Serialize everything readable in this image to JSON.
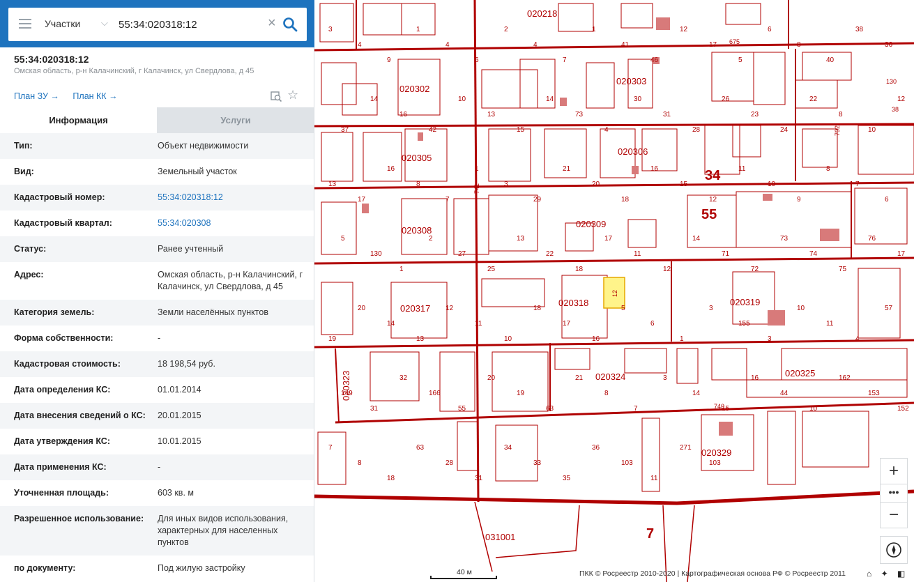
{
  "search": {
    "layer": "Участки",
    "value": "55:34:020318:12"
  },
  "object": {
    "title": "55:34:020318:12",
    "address": "Омская область, р-н Калачинский, г Калачинск, ул Свердлова, д 45",
    "plan_zu": "План ЗУ →",
    "plan_kk": "План КК →"
  },
  "tabs": {
    "info": "Информация",
    "services": "Услуги"
  },
  "properties": [
    {
      "k": "Тип:",
      "v": "Объект недвижимости"
    },
    {
      "k": "Вид:",
      "v": "Земельный участок"
    },
    {
      "k": "Кадастровый номер:",
      "v": "55:34:020318:12"
    },
    {
      "k": "Кадастровый квартал:",
      "v": "55:34:020308"
    },
    {
      "k": "Статус:",
      "v": "Ранее учтенный"
    },
    {
      "k": "Адрес:",
      "v": "Омская область, р-н Калачинский, г Калачинск, ул Свердлова, д 45"
    },
    {
      "k": "Категория земель:",
      "v": "Земли населённых пунктов"
    },
    {
      "k": "Форма собственности:",
      "v": "-"
    },
    {
      "k": "Кадастровая стоимость:",
      "v": "18 198,54 руб."
    },
    {
      "k": "Дата определения КС:",
      "v": "01.01.2014"
    },
    {
      "k": "Дата внесения сведений о КС:",
      "v": "20.01.2015"
    },
    {
      "k": "Дата утверждения КС:",
      "v": "10.01.2015"
    },
    {
      "k": "Дата применения КС:",
      "v": "-"
    },
    {
      "k": "Уточненная площадь:",
      "v": "603 кв. м"
    },
    {
      "k": "Разрешенное использование:",
      "v": "Для иных видов использования, характерных для населенных пунктов"
    },
    {
      "k": "по документу:",
      "v": "Под жилую застройку"
    }
  ],
  "map": {
    "quarters": [
      "020218",
      "020303",
      "020302",
      "020305",
      "020306",
      "020308",
      "020309",
      "020317",
      "020318",
      "020319",
      "020323",
      "020324",
      "020325",
      "020329",
      "031001"
    ],
    "district_labels": [
      "34",
      "55",
      "7"
    ],
    "street_labels": [
      "675",
      "740",
      "741",
      "792"
    ],
    "parcels": [
      "3",
      "4",
      "9",
      "1",
      "4",
      "6",
      "2",
      "4",
      "7",
      "1",
      "41",
      "46",
      "12",
      "17",
      "5",
      "6",
      "8",
      "40",
      "38",
      "36",
      "37",
      "14",
      "16",
      "42",
      "10",
      "13",
      "15",
      "14",
      "73",
      "4",
      "30",
      "31",
      "28",
      "26",
      "23",
      "24",
      "22",
      "8",
      "10",
      "12",
      "13",
      "17",
      "16",
      "8",
      "7",
      "1",
      "3",
      "29",
      "21",
      "20",
      "18",
      "16",
      "15",
      "12",
      "11",
      "10",
      "9",
      "8",
      "7",
      "6",
      "5",
      "130",
      "1",
      "2",
      "27",
      "25",
      "13",
      "22",
      "18",
      "17",
      "11",
      "12",
      "14",
      "71",
      "72",
      "73",
      "74",
      "75",
      "76",
      "17",
      "19",
      "20",
      "14",
      "13",
      "12",
      "11",
      "10",
      "18",
      "17",
      "16",
      "5",
      "6",
      "1",
      "3",
      "155",
      "3",
      "10",
      "11",
      "4",
      "57",
      "149",
      "31",
      "32",
      "166",
      "55",
      "20",
      "19",
      "63",
      "21",
      "8",
      "7",
      "3",
      "14",
      "15",
      "16",
      "44",
      "10",
      "162",
      "153",
      "152",
      "7",
      "8",
      "18",
      "63",
      "28",
      "31",
      "34",
      "33",
      "35",
      "36",
      "103",
      "11",
      "271",
      "103"
    ],
    "highlighted_parcel": "12",
    "street_extra": [
      "130",
      "38"
    ]
  },
  "controls": {
    "zoom_in": "+",
    "more": "•••",
    "zoom_out": "−"
  },
  "scale": "40 м",
  "attribution": "ПКК © Росреестр 2010-2020 | Картографическая основа РФ © Росреестр 2011"
}
